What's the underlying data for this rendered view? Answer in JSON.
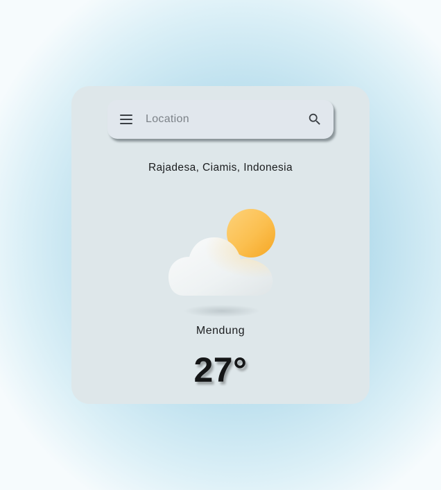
{
  "search": {
    "placeholder": "Location",
    "value": ""
  },
  "location": {
    "name": "Rajadesa, Ciamis, Indonesia"
  },
  "weather": {
    "condition": "Mendung",
    "temperature": "27°",
    "icon": "partly-cloudy-icon"
  },
  "icons": {
    "menu": "menu-icon",
    "search": "search-icon"
  },
  "colors": {
    "card_background": "#dee7ea",
    "search_background": "#e1e7ed",
    "sun": "#fbbf4f",
    "cloud": "#f2f5f6",
    "text": "#1a1c1e"
  }
}
